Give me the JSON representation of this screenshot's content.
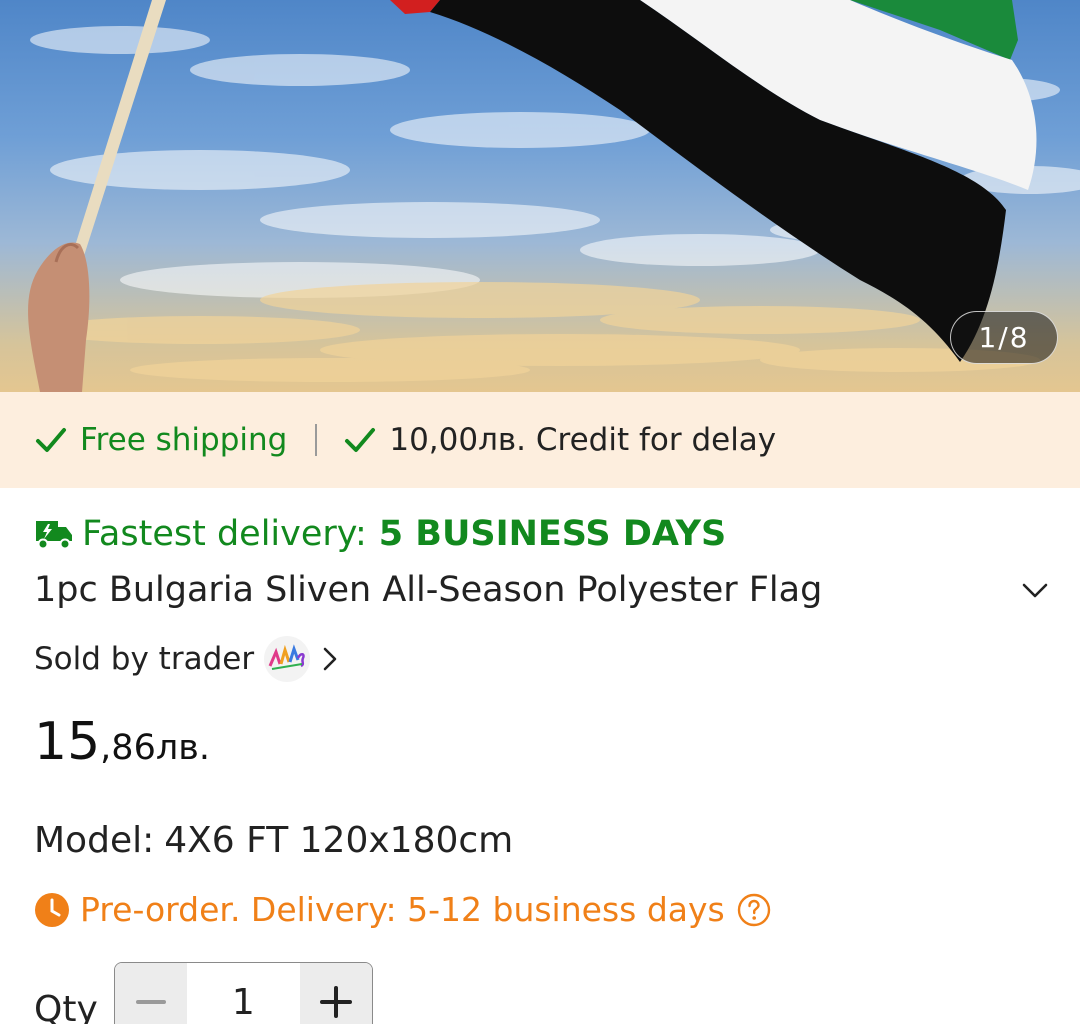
{
  "gallery": {
    "counter": "1/8",
    "image_icon": "product-photo-flag"
  },
  "promo": {
    "free_shipping": "Free shipping",
    "credit": "10,00лв. Credit for delay",
    "check_color": "#12891e",
    "background": "#fdeede"
  },
  "delivery": {
    "label": "Fastest delivery:",
    "value": "5 BUSINESS DAYS",
    "icon": "delivery-truck-icon",
    "color": "#12891e"
  },
  "product": {
    "title": "1pc Bulgaria Sliven All-Season Polyester Flag",
    "seller_text": "Sold by trader"
  },
  "price": {
    "integer": "15",
    "fraction": ",86лв."
  },
  "model": {
    "label": "Model:",
    "value": "4X6 FT 120x180cm"
  },
  "preorder": {
    "text": "Pre-order. Delivery: 5-12 business days",
    "color": "#f08018"
  },
  "quantity": {
    "label": "Qty",
    "value": "1"
  }
}
